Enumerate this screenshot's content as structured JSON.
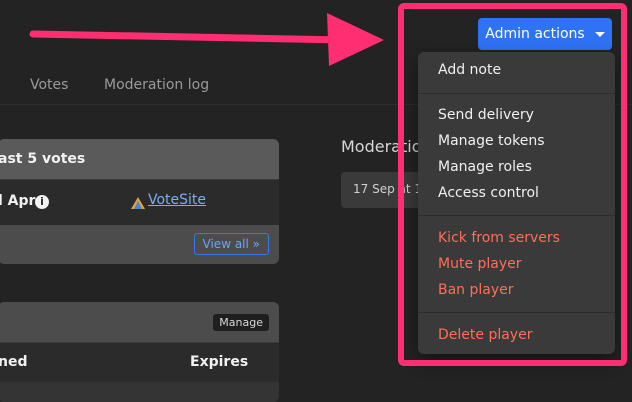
{
  "tabs": [
    {
      "label": "Votes"
    },
    {
      "label": "Moderation log"
    }
  ],
  "votes_card": {
    "title": "ast 5 votes",
    "date": "l Apr",
    "info_icon": "info-icon",
    "site_name": "VoteSite",
    "view_all": "View all »"
  },
  "second_card": {
    "manage_label": "Manage",
    "col_named": "ned",
    "col_expires": "Expires"
  },
  "moderation": {
    "title": "Moderation",
    "entry_date": "17 Sep at 1"
  },
  "admin": {
    "button_label": "Admin actions",
    "menu": {
      "group1": [
        "Add note"
      ],
      "group2": [
        "Send delivery",
        "Manage tokens",
        "Manage roles",
        "Access control"
      ],
      "group3": [
        "Kick from servers",
        "Mute player",
        "Ban player"
      ],
      "group4": [
        "Delete player"
      ]
    }
  },
  "colors": {
    "accent": "#2f73f5",
    "danger": "#ff6e57",
    "highlight": "#ff2d72",
    "link": "#7aaef7"
  }
}
